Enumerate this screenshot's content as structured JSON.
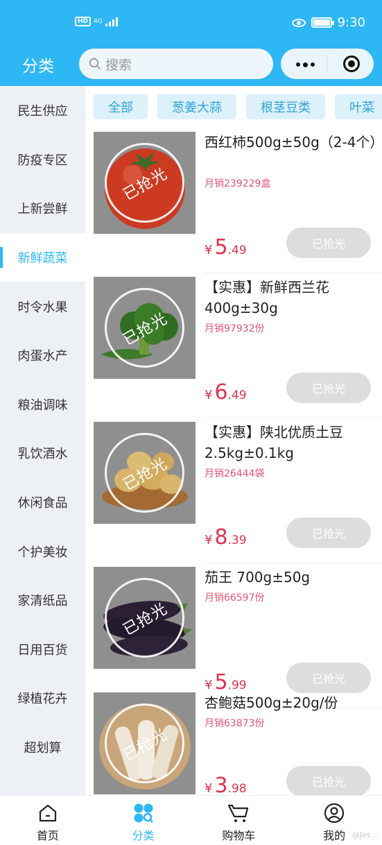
{
  "status_bar": {
    "hd": "HD",
    "network": "4G",
    "time": "9:30"
  },
  "header": {
    "title": "分类",
    "search_placeholder": "搜索"
  },
  "sidebar": {
    "items": [
      {
        "label": "民生供应"
      },
      {
        "label": "防疫专区"
      },
      {
        "label": "上新尝鲜"
      },
      {
        "label": "新鲜蔬菜",
        "active": true
      },
      {
        "label": "时令水果"
      },
      {
        "label": "肉蛋水产"
      },
      {
        "label": "粮油调味"
      },
      {
        "label": "乳饮酒水"
      },
      {
        "label": "休闲食品"
      },
      {
        "label": "个护美妆"
      },
      {
        "label": "家清纸品"
      },
      {
        "label": "日用百货"
      },
      {
        "label": "绿植花卉"
      },
      {
        "label": "超划算"
      }
    ]
  },
  "chips": [
    "全部",
    "葱姜大蒜",
    "根茎豆类",
    "叶菜"
  ],
  "products": [
    {
      "name": "西红柿500g±50g（2-4个）",
      "sales": "月销239229盒",
      "price_int": "5",
      "price_dec": ".49",
      "stamp": "已抢光",
      "button": "已抢光",
      "image": "tomato"
    },
    {
      "name": "【实惠】新鲜西兰花400g±30g",
      "sales": "月销97932份",
      "price_int": "6",
      "price_dec": ".49",
      "stamp": "已抢光",
      "button": "已抢光",
      "image": "broccoli"
    },
    {
      "name": "【实惠】陕北优质土豆2.5kg±0.1kg",
      "sales": "月销26444袋",
      "price_int": "8",
      "price_dec": ".39",
      "stamp": "已抢光",
      "button": "已抢光",
      "image": "potato"
    },
    {
      "name": "茄王 700g±50g",
      "sales": "月销66597份",
      "price_int": "5",
      "price_dec": ".99",
      "stamp": "已抢光",
      "button": "已抢光",
      "image": "eggplant"
    },
    {
      "name": "杏鲍菇500g±20g/份",
      "sales": "月销63873份",
      "price_int": "3",
      "price_dec": ".98",
      "stamp": "已抢光",
      "button": "已抢光",
      "image": "king-oyster-mushroom"
    }
  ],
  "currency": "¥",
  "tabbar": [
    {
      "label": "首页",
      "icon": "home-icon"
    },
    {
      "label": "分类",
      "icon": "category-icon",
      "active": true
    },
    {
      "label": "购物车",
      "icon": "cart-icon"
    },
    {
      "label": "我的",
      "icon": "profile-icon"
    }
  ],
  "watermark": "@Jes...",
  "colors": {
    "accent": "#2db7f5",
    "price": "#e0314f",
    "sales": "#e35574",
    "sold_button": "#dddddd"
  }
}
